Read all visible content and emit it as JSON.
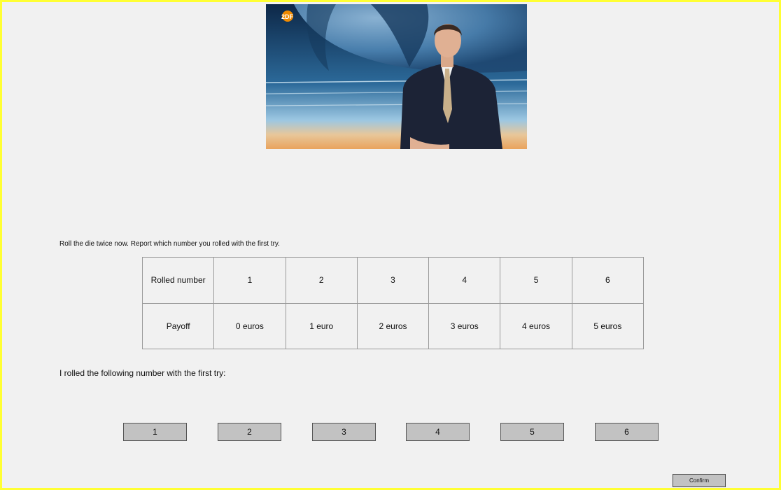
{
  "video": {
    "logo_text": "2DF"
  },
  "instruction": "Roll the die twice now. Report which number you rolled with the first try.",
  "table": {
    "rows": [
      {
        "header": "Rolled number",
        "cells": [
          "1",
          "2",
          "3",
          "4",
          "5",
          "6"
        ]
      },
      {
        "header": "Payoff",
        "cells": [
          "0 euros",
          "1 euro",
          "2 euros",
          "3 euros",
          "4 euros",
          "5 euros"
        ]
      }
    ]
  },
  "question": "I rolled the following number with the first try:",
  "choices": [
    "1",
    "2",
    "3",
    "4",
    "5",
    "6"
  ],
  "confirm_label": "Confirm",
  "colors": {
    "frame_border": "#ffff33",
    "background": "#f1f1f1",
    "button_fill": "#c2c2c2"
  }
}
